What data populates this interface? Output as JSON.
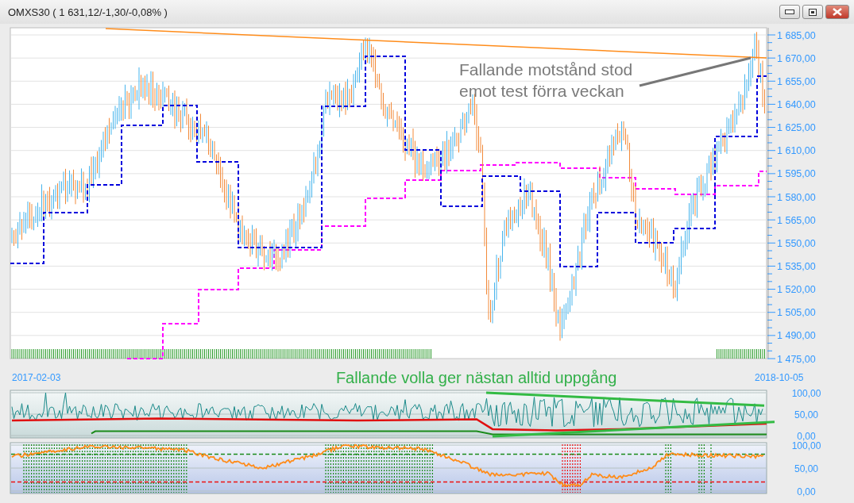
{
  "window": {
    "title": "OMXS30 ( 1 631,12/-1,30/-0,08% )"
  },
  "price_chart": {
    "y_axis_labels": [
      "1 685,00",
      "1 670,00",
      "1 655,00",
      "1 640,00",
      "1 625,00",
      "1 610,00",
      "1 595,00",
      "1 580,00",
      "1 565,00",
      "1 550,00",
      "1 535,00",
      "1 520,00",
      "1 505,00",
      "1 490,00",
      "1 475,00"
    ],
    "annotation": "Fallande motstånd stod emot test förra veckan"
  },
  "date_row": {
    "start_date": "2017-02-03",
    "note": "Fallande volla ger nästan alltid uppgång",
    "end_date": "2018-10-05"
  },
  "volatility_panel": {
    "y_axis_labels": [
      "100,00",
      "50,00",
      "0,00"
    ]
  },
  "oscillator_panel": {
    "y_axis_labels": [
      "100,00",
      "50,00",
      "0,00"
    ]
  }
}
